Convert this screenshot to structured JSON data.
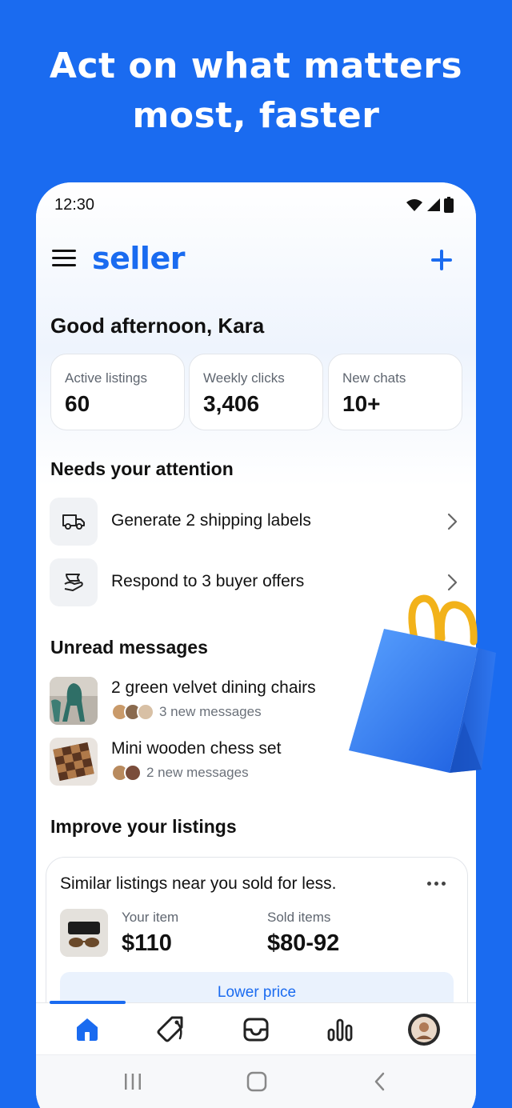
{
  "headline": {
    "line1": "Act on what matters",
    "line2": "most, faster"
  },
  "status_bar": {
    "time": "12:30"
  },
  "app_bar": {
    "brand": "seller"
  },
  "greeting": "Good afternoon, Kara",
  "stats": [
    {
      "label": "Active listings",
      "value": "60"
    },
    {
      "label": "Weekly clicks",
      "value": "3,406"
    },
    {
      "label": "New chats",
      "value": "10+"
    }
  ],
  "attention": {
    "title": "Needs your attention",
    "items": [
      {
        "label": "Generate 2 shipping labels",
        "icon": "truck-icon"
      },
      {
        "label": "Respond to 3 buyer offers",
        "icon": "offer-icon"
      }
    ]
  },
  "messages": {
    "title": "Unread messages",
    "items": [
      {
        "title": "2 green velvet dining chairs",
        "count": "3 new messages"
      },
      {
        "title": "Mini wooden chess set",
        "count": "2 new messages"
      }
    ]
  },
  "improve": {
    "title": "Improve your listings",
    "card": {
      "text": "Similar listings near you sold for less.",
      "your_item_label": "Your item",
      "your_item_price": "$110",
      "sold_label": "Sold items",
      "sold_price": "$80-92",
      "button": "Lower price"
    }
  },
  "bottom_nav": [
    "home-icon",
    "tag-icon",
    "inbox-icon",
    "stats-icon",
    "profile-avatar"
  ],
  "colors": {
    "brand": "#1a6bf0",
    "text": "#111111",
    "muted": "#5f6670"
  }
}
